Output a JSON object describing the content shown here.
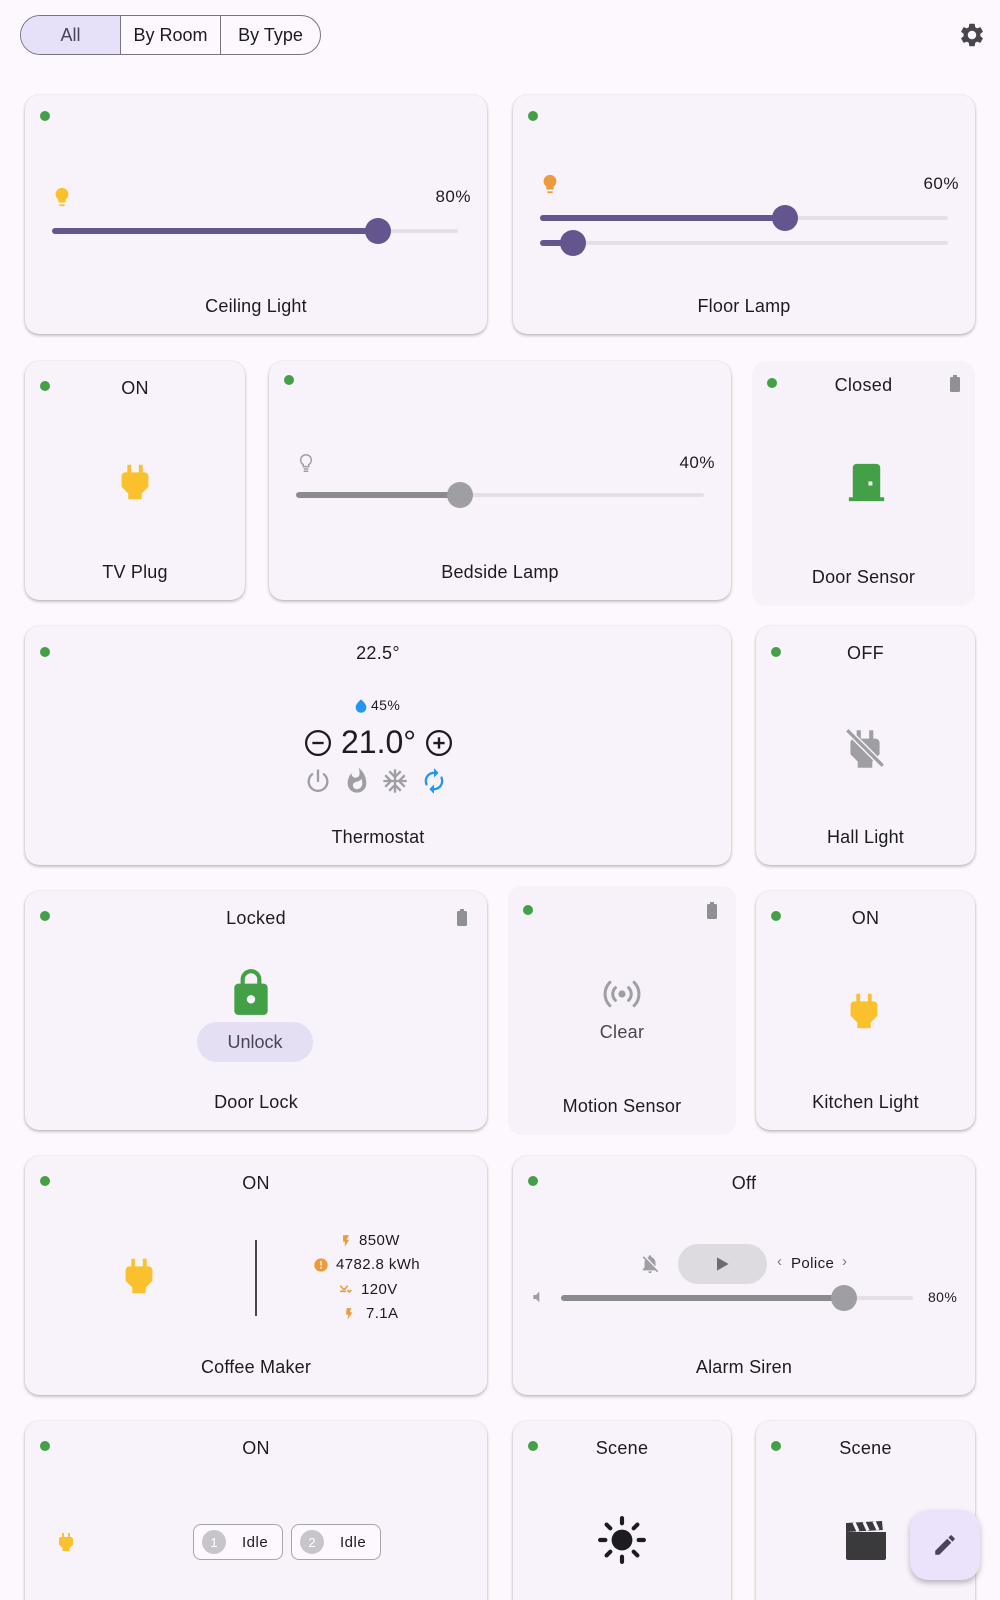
{
  "filter": {
    "tabs": [
      "All",
      "By Room",
      "By Type"
    ],
    "selected": "All"
  },
  "header": {
    "settings_icon": "gear-icon"
  },
  "colors": {
    "accent": "#65558f",
    "online": "#43a047",
    "plug": "#fbc02d",
    "lock": "#43a047"
  },
  "cards": {
    "ceiling_light": {
      "title": "Ceiling Light",
      "brightness_label": "80%",
      "brightness": 0.8
    },
    "floor_lamp": {
      "title": "Floor Lamp",
      "brightness_label": "60%",
      "brightness": 0.6,
      "color_temp": 0.08
    },
    "tv_plug": {
      "title": "TV Plug",
      "status": "ON"
    },
    "bedside_lamp": {
      "title": "Bedside Lamp",
      "brightness_label": "40%",
      "brightness": 0.4
    },
    "door_sensor": {
      "title": "Door Sensor",
      "status": "Closed"
    },
    "thermostat": {
      "title": "Thermostat",
      "current_temp": "22.5°",
      "humidity": "45%",
      "target_temp": "21.0°"
    },
    "hall_light": {
      "title": "Hall Light",
      "status": "OFF"
    },
    "door_lock": {
      "title": "Door Lock",
      "status": "Locked",
      "action": "Unlock"
    },
    "motion_sensor": {
      "title": "Motion Sensor",
      "status": "Clear"
    },
    "kitchen_light": {
      "title": "Kitchen Light",
      "status": "ON"
    },
    "coffee_maker": {
      "title": "Coffee Maker",
      "status": "ON",
      "power": "850W",
      "energy": "4782.8 kWh",
      "voltage": "120V",
      "current": "7.1A"
    },
    "alarm_siren": {
      "title": "Alarm Siren",
      "status": "Off",
      "tone": "Police",
      "volume_label": "80%",
      "volume": 0.8
    },
    "power_strip": {
      "status": "ON",
      "outlets": [
        {
          "num": "1",
          "state": "Idle"
        },
        {
          "num": "2",
          "state": "Idle"
        }
      ]
    },
    "scene_1": {
      "status": "Scene"
    },
    "scene_2": {
      "status": "Scene"
    }
  }
}
